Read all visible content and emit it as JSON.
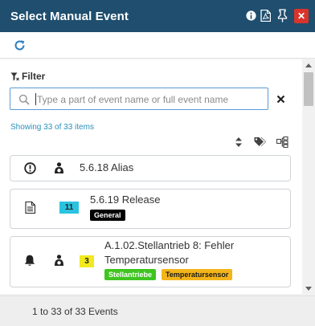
{
  "window": {
    "title": "Select Manual Event"
  },
  "titlebar_icons": [
    "info-icon",
    "pdf-icon",
    "pin-icon",
    "close-icon"
  ],
  "toolbar": {
    "refresh_icon": "refresh-icon"
  },
  "filter": {
    "label": "Filter",
    "placeholder": "Type a part of event name or full event name",
    "value": "",
    "clear_icon": "clear-icon"
  },
  "showing": "Showing 33 of 33 items",
  "list_tools": [
    "sort-icon",
    "tags-icon",
    "hierarchy-icon"
  ],
  "events": [
    {
      "name": "5.6.18 Alias",
      "icons": [
        "exclamation-circle-icon",
        "assign-user-icon"
      ],
      "count": null,
      "tags": []
    },
    {
      "name": "5.6.19 Release",
      "icons": [
        "document-icon"
      ],
      "count": "11",
      "count_color": "#29c3e0",
      "tags": [
        {
          "label": "General",
          "bg": "#000000",
          "fg": "#ffffff"
        }
      ]
    },
    {
      "name_line1": "A.1.02.Stellantrieb 8: Fehler",
      "name_line2": "Temperatursensor",
      "icons": [
        "bell-icon",
        "assign-user-icon"
      ],
      "count": "3",
      "count_color": "#f2ea1f",
      "tags": [
        {
          "label": "Stellantriebe",
          "bg": "#3ec51f",
          "fg": "#ffffff"
        },
        {
          "label": "Temperatursensor",
          "bg": "#f3b51b",
          "fg": "#1a1a1a"
        }
      ]
    }
  ],
  "footer": {
    "text": "1 to 33 of 33 Events"
  }
}
